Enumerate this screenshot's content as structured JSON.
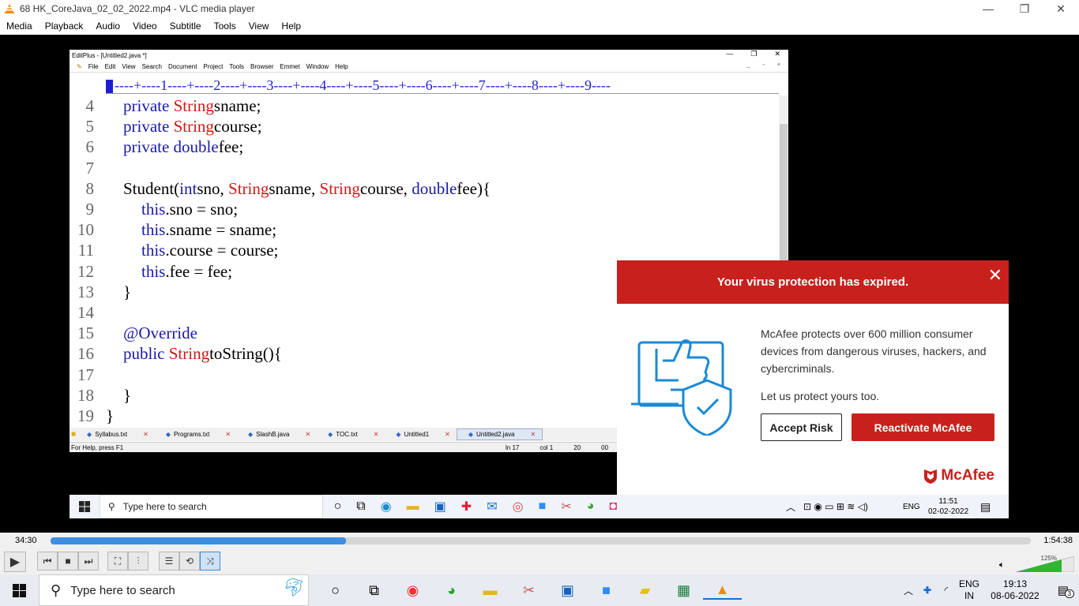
{
  "vlc": {
    "title": "68 HK_CoreJava_02_02_2022.mp4 - VLC media player",
    "menu": [
      "Media",
      "Playback",
      "Audio",
      "Video",
      "Subtitle",
      "Tools",
      "View",
      "Help"
    ],
    "time_elapsed": "34:30",
    "time_total": "1:54:38",
    "progress": 0.301,
    "volume": "125%"
  },
  "editplus": {
    "title": "EditPlus - [Untitled2.java *]",
    "menu": [
      "File",
      "Edit",
      "View",
      "Search",
      "Document",
      "Project",
      "Tools",
      "Browser",
      "Emmet",
      "Window",
      "Help"
    ],
    "ruler": "----+----1----+----2----+----3----+----4----+----5----+----6----+----7----+----8----+----9----",
    "tabs": [
      "Syllabus.txt",
      "Programs.txt",
      "SlashB.java",
      "TOC.txt",
      "Untitled1",
      "Untitled2.java"
    ],
    "active_tab": "Untitled2.java",
    "status_help": "For Help, press F1",
    "status_ln": "ln 17",
    "status_col": "col 1",
    "status_num": "20",
    "status_code": "00"
  },
  "code_lines": [
    {
      "n": "4",
      "indent": 1,
      "parts": [
        [
          "kw",
          "private "
        ],
        [
          "ty",
          "String"
        ],
        [
          "",
          "sname;"
        ]
      ]
    },
    {
      "n": "5",
      "indent": 1,
      "parts": [
        [
          "kw",
          "private "
        ],
        [
          "ty",
          "String"
        ],
        [
          "",
          "course;"
        ]
      ]
    },
    {
      "n": "6",
      "indent": 1,
      "parts": [
        [
          "kw",
          "private double"
        ],
        [
          "",
          "fee;"
        ]
      ]
    },
    {
      "n": "7",
      "indent": 0,
      "parts": []
    },
    {
      "n": "8",
      "indent": 1,
      "parts": [
        [
          "",
          "Student("
        ],
        [
          "kw",
          "int"
        ],
        [
          "",
          "sno, "
        ],
        [
          "ty",
          "String"
        ],
        [
          "",
          "sname, "
        ],
        [
          "ty",
          "String"
        ],
        [
          "",
          "course, "
        ],
        [
          "kw",
          "double"
        ],
        [
          "",
          "fee){"
        ]
      ]
    },
    {
      "n": "9",
      "indent": 2,
      "parts": [
        [
          "kw",
          "this"
        ],
        [
          "",
          ".sno = sno;"
        ]
      ]
    },
    {
      "n": "10",
      "indent": 2,
      "parts": [
        [
          "kw",
          "this"
        ],
        [
          "",
          ".sname = sname;"
        ]
      ]
    },
    {
      "n": "11",
      "indent": 2,
      "parts": [
        [
          "kw",
          "this"
        ],
        [
          "",
          ".course = course;"
        ]
      ]
    },
    {
      "n": "12",
      "indent": 2,
      "parts": [
        [
          "kw",
          "this"
        ],
        [
          "",
          ".fee = fee;"
        ]
      ]
    },
    {
      "n": "13",
      "indent": 1,
      "parts": [
        [
          "",
          "}"
        ]
      ]
    },
    {
      "n": "14",
      "indent": 0,
      "parts": []
    },
    {
      "n": "15",
      "indent": 1,
      "parts": [
        [
          "kw",
          "@Override"
        ]
      ]
    },
    {
      "n": "16",
      "indent": 1,
      "parts": [
        [
          "kw",
          "public "
        ],
        [
          "ty",
          "String"
        ],
        [
          "",
          "toString(){"
        ]
      ]
    },
    {
      "n": "17",
      "indent": 0,
      "parts": []
    },
    {
      "n": "18",
      "indent": 1,
      "parts": [
        [
          "",
          "}"
        ]
      ]
    },
    {
      "n": "19",
      "indent": 0,
      "parts": [
        [
          "",
          "}"
        ]
      ]
    }
  ],
  "mcafee": {
    "header": "Your virus protection has expired.",
    "body": "McAfee protects over 600 million consumer devices from dangerous viruses, hackers, and cybercriminals.",
    "body2": "Let us protect yours too.",
    "accept": "Accept Risk",
    "reactivate": "Reactivate McAfee",
    "logo": "McAfee",
    "brand_color": "#c8201c"
  },
  "inner_taskbar": {
    "search_placeholder": "Type here to search",
    "lang": "ENG",
    "time": "11:51",
    "date": "02-02-2022"
  },
  "taskbar": {
    "search_placeholder": "Type here to search",
    "lang": "ENG",
    "region": "IN",
    "time": "19:13",
    "date": "08-06-2022",
    "notifications": "3"
  }
}
